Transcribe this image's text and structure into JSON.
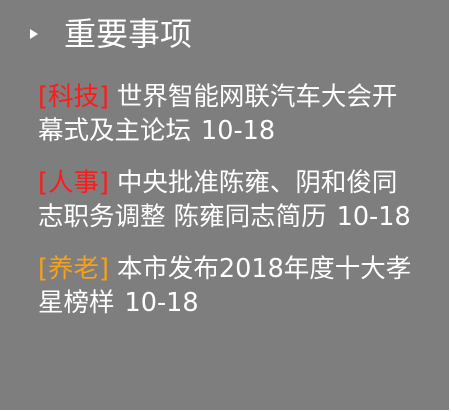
{
  "panel": {
    "title": "重要事项",
    "items": [
      {
        "category": "[科技]",
        "category_color": "#ff1a1a",
        "title": "世界智能网联汽车大会开幕式及主论坛",
        "date": "10-18"
      },
      {
        "category": "[人事]",
        "category_color": "#ff1a1a",
        "title": "中央批准陈雍、阴和俊同志职务调整 陈雍同志简历",
        "date": "10-18"
      },
      {
        "category": "[养老]",
        "category_color": "#f5a21a",
        "title": "本市发布2018年度十大孝星榜样",
        "date": "10-18"
      }
    ]
  },
  "colors": {
    "panel_bg": "#7e7e7e",
    "text": "#ffffff"
  }
}
